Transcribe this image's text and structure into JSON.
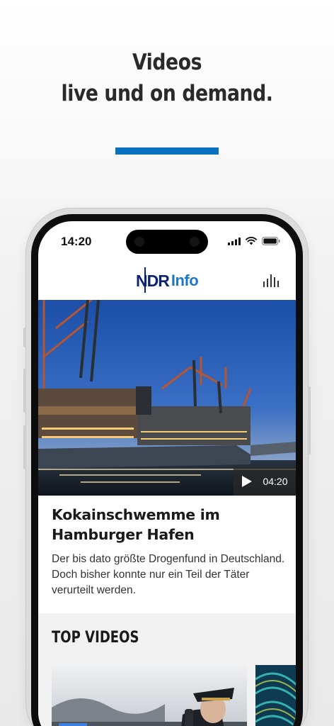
{
  "promo": {
    "headline_line1": "Videos",
    "headline_line2": "live und on demand.",
    "accent_color": "#0b6fbf"
  },
  "status_bar": {
    "time": "14:20",
    "icons": [
      "cellular-signal-icon",
      "wifi-icon",
      "battery-icon"
    ]
  },
  "app": {
    "logo_ndr": "NDR",
    "logo_info": "Info",
    "logo_colors": {
      "ndr": "#0b2470",
      "info": "#1c77c8"
    },
    "audio_button_icon": "audio-levels-icon"
  },
  "featured_video": {
    "image": "container-ship-at-hamburg-port-dusk",
    "duration": "04:20",
    "play_icon": "play-icon",
    "title": "Kokainschwemme im Hamburger Hafen",
    "teaser": "Der bis dato größte Drogenfund in Deutschland. Doch bisher konnte nur ein Teil der Täter verurteilt werden."
  },
  "top_videos": {
    "section_title": "TOP VIDEOS",
    "items": [
      {
        "image": "police-officer-with-phone"
      },
      {
        "image": "blue-green-abstract-lines"
      }
    ]
  }
}
